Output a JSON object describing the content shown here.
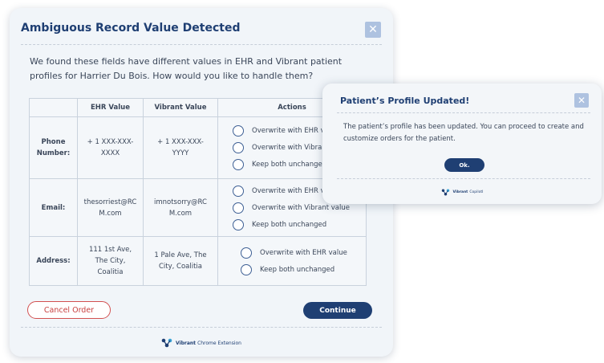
{
  "dialog": {
    "title": "Ambiguous Record Value Detected",
    "close_symbol": "✕",
    "message": "We found these fields have different values in EHR and Vibrant patient profiles for Harrier Du Bois. How would you like to handle them?",
    "table": {
      "headers": [
        "",
        "EHR Value",
        "Vibrant Value",
        "Actions"
      ],
      "rows": [
        {
          "label_lines": [
            "Phone",
            "Number:"
          ],
          "ehr_lines": [
            "+ 1 XXX-XXX-",
            "XXXX"
          ],
          "vibrant_lines": [
            "+ 1 XXX-XXX-",
            "YYYY"
          ],
          "options": [
            "Overwrite with EHR value",
            "Overwrite with Vibrant value",
            "Keep both unchanged"
          ]
        },
        {
          "label_lines": [
            "Email:"
          ],
          "ehr_lines": [
            "thesorriest@RC",
            "M.com"
          ],
          "vibrant_lines": [
            "imnotsorry@RC",
            "M.com"
          ],
          "options": [
            "Overwrite with EHR value",
            "Overwrite with Vibrant value",
            "Keep both unchanged"
          ]
        },
        {
          "label_lines": [
            "Address:"
          ],
          "ehr_lines": [
            "111 1st Ave,",
            "The City,",
            "Coalitia"
          ],
          "vibrant_lines": [
            "1 Pale Ave, The",
            "City, Coalitia"
          ],
          "options": [
            "Overwrite with EHR value",
            "Keep both unchanged"
          ]
        }
      ]
    },
    "cancel_label": "Cancel Order",
    "continue_label": "Continue",
    "footer_brand": "Vibrant",
    "footer_product": "Chrome Extension"
  },
  "popup": {
    "title": "Patient’s Profile Updated!",
    "close_symbol": "✕",
    "message": "The patient’s profile has been updated. You can proceed to create and customize orders for the patient.",
    "ok_label": "Ok.",
    "footer_brand": "Vibrant",
    "footer_product": "CopilotI"
  },
  "icons": {
    "close": "close-icon",
    "logo": "vibrant-logo-icon",
    "radio": "radio-unchecked-icon"
  },
  "colors": {
    "primary": "#1f3f73",
    "danger": "#d25050",
    "close_bg": "#aec2e0",
    "background": "#f1f5f9"
  }
}
